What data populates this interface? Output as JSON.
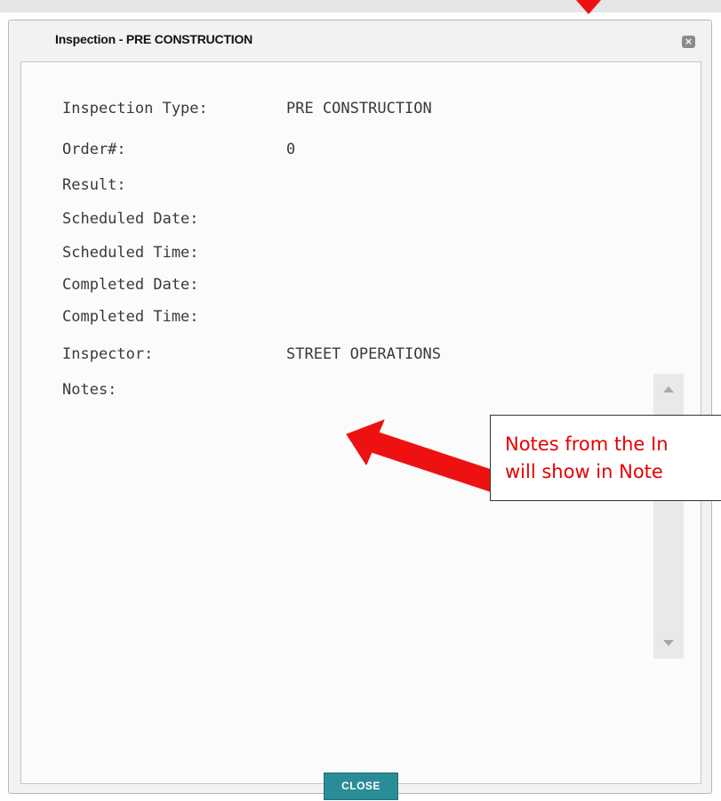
{
  "dialog": {
    "title": "Inspection - PRE CONSTRUCTION",
    "close_icon": "close-icon"
  },
  "fields": [
    {
      "label": "Inspection Type:",
      "value": "PRE CONSTRUCTION"
    },
    {
      "label": "Order#:",
      "value": "0"
    },
    {
      "label": "Result:",
      "value": ""
    },
    {
      "label": "Scheduled Date:",
      "value": ""
    },
    {
      "label": "Scheduled Time:",
      "value": ""
    },
    {
      "label": "Completed Date:",
      "value": ""
    },
    {
      "label": "Completed Time:",
      "value": ""
    },
    {
      "label": "Inspector:",
      "value": "STREET OPERATIONS"
    },
    {
      "label": "Notes:",
      "value": ""
    }
  ],
  "scrollbar": {
    "up_icon": "scroll-up-arrow-icon",
    "down_icon": "scroll-down-arrow-icon"
  },
  "buttons": {
    "close_label": "CLOSE"
  },
  "annotation": {
    "line1": "Notes from the In",
    "line2": "will show in Note",
    "color": "#e60000",
    "arrow_icon": "pointer-arrow-icon"
  }
}
